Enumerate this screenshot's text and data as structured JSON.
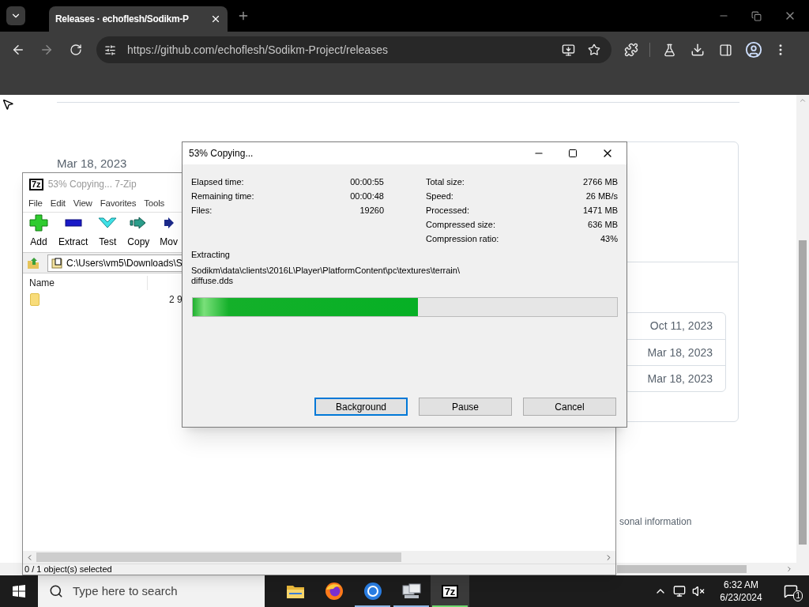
{
  "browser": {
    "tabs": [
      {
        "title": "Releases · echoflesh/Sodikm-P",
        "selected": true
      }
    ],
    "url": "https://github.com/echoflesh/Sodikm-Project/releases"
  },
  "page": {
    "side_date": "Mar 18, 2023",
    "release_dates": [
      "Oct 11, 2023",
      "Mar 18, 2023",
      "Mar 18, 2023"
    ],
    "footer_text": "sonal information"
  },
  "archiver": {
    "title": "53% Copying... 7-Zip",
    "logo": "7z",
    "menu": [
      "File",
      "Edit",
      "View",
      "Favorites",
      "Tools"
    ],
    "toolbar": [
      {
        "kind": "add",
        "label": "Add"
      },
      {
        "kind": "extract",
        "label": "Extract"
      },
      {
        "kind": "test",
        "label": "Test"
      },
      {
        "kind": "copy",
        "label": "Copy"
      },
      {
        "kind": "move",
        "label": "Mov"
      }
    ],
    "path": "C:\\Users\\vm5\\Downloads\\S",
    "columns": [
      "Name"
    ],
    "rows": [
      {
        "column_2": "2 9"
      }
    ],
    "status": "0 / 1 object(s) selected"
  },
  "dialog": {
    "title": "53% Copying...",
    "left_stats": [
      {
        "label": "Elapsed time:",
        "value": "00:00:55"
      },
      {
        "label": "Remaining time:",
        "value": "00:00:48"
      },
      {
        "label": "Files:",
        "value": "19260"
      }
    ],
    "right_stats": [
      {
        "label": "Total size:",
        "value": "2766 MB"
      },
      {
        "label": "Speed:",
        "value": "26 MB/s"
      },
      {
        "label": "Processed:",
        "value": "1471 MB"
      },
      {
        "label": "Compressed size:",
        "value": "636 MB"
      },
      {
        "label": "Compression ratio:",
        "value": "43%"
      }
    ],
    "operation": "Extracting",
    "file_lines": [
      "Sodikm\\data\\clients\\2016L\\Player\\PlatformContent\\pc\\textures\\terrain\\",
      "diffuse.dds"
    ],
    "progress": {
      "level": 0.53
    },
    "buttons": [
      {
        "label": "Background",
        "selected": true
      },
      {
        "label": "Pause",
        "selected": false
      },
      {
        "label": "Cancel",
        "selected": false
      }
    ]
  },
  "taskbar": {
    "search_placeholder": "Type here to search",
    "apps": [
      {
        "kind": "folder",
        "running": false,
        "selected": false
      },
      {
        "kind": "firefox",
        "running": false,
        "selected": false
      },
      {
        "kind": "chrome",
        "running": true,
        "selected": false
      },
      {
        "kind": "utility",
        "running": true,
        "selected": false
      },
      {
        "kind": "sevenzip",
        "label": "7z",
        "running": true,
        "selected": true
      }
    ],
    "time": "6:32 AM",
    "date": "6/23/2024",
    "notifications": "1"
  }
}
